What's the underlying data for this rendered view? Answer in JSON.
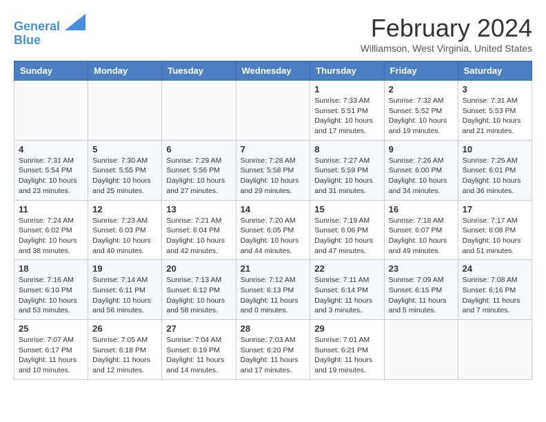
{
  "header": {
    "logo_line1": "General",
    "logo_line2": "Blue",
    "month_title": "February 2024",
    "location": "Williamson, West Virginia, United States"
  },
  "days_of_week": [
    "Sunday",
    "Monday",
    "Tuesday",
    "Wednesday",
    "Thursday",
    "Friday",
    "Saturday"
  ],
  "weeks": [
    [
      {
        "day": "",
        "info": ""
      },
      {
        "day": "",
        "info": ""
      },
      {
        "day": "",
        "info": ""
      },
      {
        "day": "",
        "info": ""
      },
      {
        "day": "1",
        "info": "Sunrise: 7:33 AM\nSunset: 5:51 PM\nDaylight: 10 hours\nand 17 minutes."
      },
      {
        "day": "2",
        "info": "Sunrise: 7:32 AM\nSunset: 5:52 PM\nDaylight: 10 hours\nand 19 minutes."
      },
      {
        "day": "3",
        "info": "Sunrise: 7:31 AM\nSunset: 5:53 PM\nDaylight: 10 hours\nand 21 minutes."
      }
    ],
    [
      {
        "day": "4",
        "info": "Sunrise: 7:31 AM\nSunset: 5:54 PM\nDaylight: 10 hours\nand 23 minutes."
      },
      {
        "day": "5",
        "info": "Sunrise: 7:30 AM\nSunset: 5:55 PM\nDaylight: 10 hours\nand 25 minutes."
      },
      {
        "day": "6",
        "info": "Sunrise: 7:29 AM\nSunset: 5:56 PM\nDaylight: 10 hours\nand 27 minutes."
      },
      {
        "day": "7",
        "info": "Sunrise: 7:28 AM\nSunset: 5:58 PM\nDaylight: 10 hours\nand 29 minutes."
      },
      {
        "day": "8",
        "info": "Sunrise: 7:27 AM\nSunset: 5:59 PM\nDaylight: 10 hours\nand 31 minutes."
      },
      {
        "day": "9",
        "info": "Sunrise: 7:26 AM\nSunset: 6:00 PM\nDaylight: 10 hours\nand 34 minutes."
      },
      {
        "day": "10",
        "info": "Sunrise: 7:25 AM\nSunset: 6:01 PM\nDaylight: 10 hours\nand 36 minutes."
      }
    ],
    [
      {
        "day": "11",
        "info": "Sunrise: 7:24 AM\nSunset: 6:02 PM\nDaylight: 10 hours\nand 38 minutes."
      },
      {
        "day": "12",
        "info": "Sunrise: 7:23 AM\nSunset: 6:03 PM\nDaylight: 10 hours\nand 40 minutes."
      },
      {
        "day": "13",
        "info": "Sunrise: 7:21 AM\nSunset: 6:04 PM\nDaylight: 10 hours\nand 42 minutes."
      },
      {
        "day": "14",
        "info": "Sunrise: 7:20 AM\nSunset: 6:05 PM\nDaylight: 10 hours\nand 44 minutes."
      },
      {
        "day": "15",
        "info": "Sunrise: 7:19 AM\nSunset: 6:06 PM\nDaylight: 10 hours\nand 47 minutes."
      },
      {
        "day": "16",
        "info": "Sunrise: 7:18 AM\nSunset: 6:07 PM\nDaylight: 10 hours\nand 49 minutes."
      },
      {
        "day": "17",
        "info": "Sunrise: 7:17 AM\nSunset: 6:08 PM\nDaylight: 10 hours\nand 51 minutes."
      }
    ],
    [
      {
        "day": "18",
        "info": "Sunrise: 7:16 AM\nSunset: 6:10 PM\nDaylight: 10 hours\nand 53 minutes."
      },
      {
        "day": "19",
        "info": "Sunrise: 7:14 AM\nSunset: 6:11 PM\nDaylight: 10 hours\nand 56 minutes."
      },
      {
        "day": "20",
        "info": "Sunrise: 7:13 AM\nSunset: 6:12 PM\nDaylight: 10 hours\nand 58 minutes."
      },
      {
        "day": "21",
        "info": "Sunrise: 7:12 AM\nSunset: 6:13 PM\nDaylight: 11 hours\nand 0 minutes."
      },
      {
        "day": "22",
        "info": "Sunrise: 7:11 AM\nSunset: 6:14 PM\nDaylight: 11 hours\nand 3 minutes."
      },
      {
        "day": "23",
        "info": "Sunrise: 7:09 AM\nSunset: 6:15 PM\nDaylight: 11 hours\nand 5 minutes."
      },
      {
        "day": "24",
        "info": "Sunrise: 7:08 AM\nSunset: 6:16 PM\nDaylight: 11 hours\nand 7 minutes."
      }
    ],
    [
      {
        "day": "25",
        "info": "Sunrise: 7:07 AM\nSunset: 6:17 PM\nDaylight: 11 hours\nand 10 minutes."
      },
      {
        "day": "26",
        "info": "Sunrise: 7:05 AM\nSunset: 6:18 PM\nDaylight: 11 hours\nand 12 minutes."
      },
      {
        "day": "27",
        "info": "Sunrise: 7:04 AM\nSunset: 6:19 PM\nDaylight: 11 hours\nand 14 minutes."
      },
      {
        "day": "28",
        "info": "Sunrise: 7:03 AM\nSunset: 6:20 PM\nDaylight: 11 hours\nand 17 minutes."
      },
      {
        "day": "29",
        "info": "Sunrise: 7:01 AM\nSunset: 6:21 PM\nDaylight: 11 hours\nand 19 minutes."
      },
      {
        "day": "",
        "info": ""
      },
      {
        "day": "",
        "info": ""
      }
    ]
  ]
}
